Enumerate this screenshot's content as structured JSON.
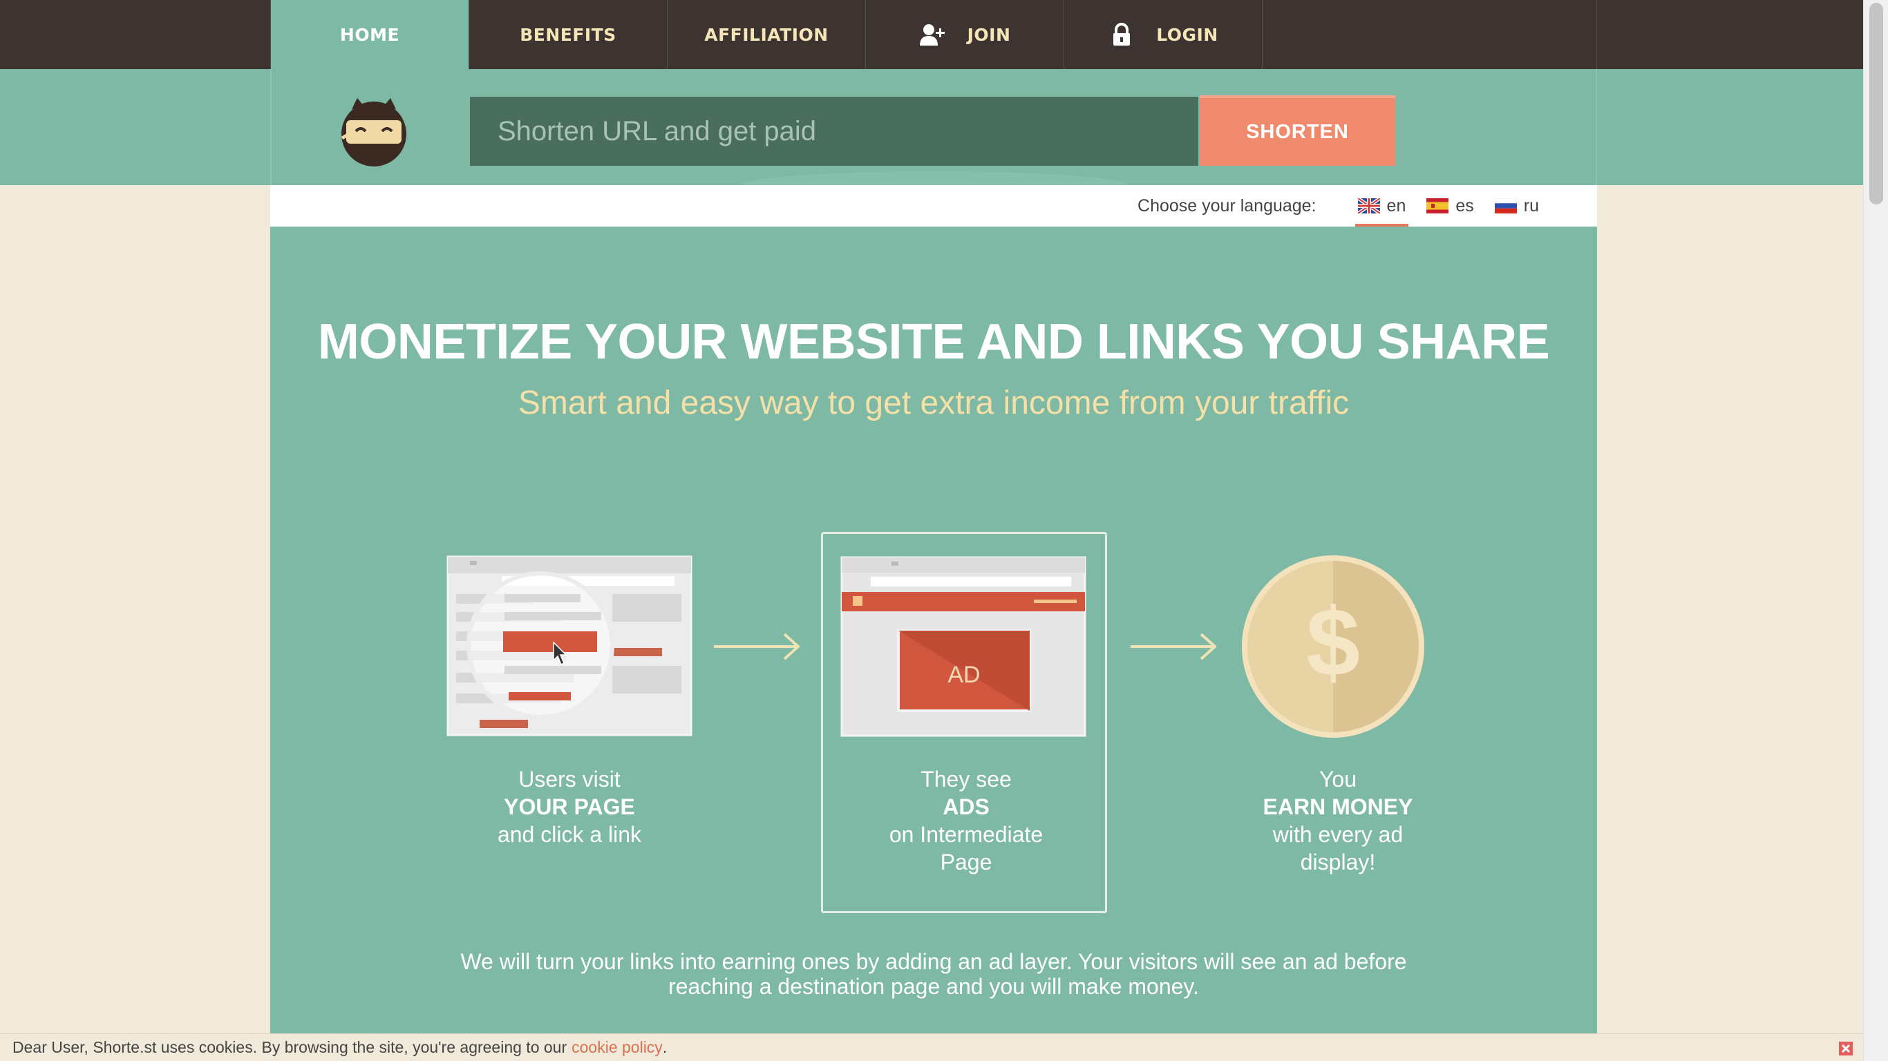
{
  "nav": {
    "items": [
      {
        "label": "HOME",
        "icon": ""
      },
      {
        "label": "BENEFITS",
        "icon": ""
      },
      {
        "label": "AFFILIATION",
        "icon": ""
      },
      {
        "label": "JOIN",
        "icon": "add-user-icon"
      },
      {
        "label": "LOGIN",
        "icon": "lock-icon"
      }
    ],
    "active": "HOME"
  },
  "shortener": {
    "placeholder": "Shorten URL and get paid",
    "value": "",
    "button_label": "SHORTEN"
  },
  "language": {
    "label": "Choose your language:",
    "options": [
      {
        "code": "en",
        "flag": "uk-flag-icon"
      },
      {
        "code": "es",
        "flag": "spain-flag-icon"
      },
      {
        "code": "ru",
        "flag": "russia-flag-icon"
      }
    ],
    "active": "en"
  },
  "hero": {
    "title": "MONETIZE YOUR WEBSITE AND LINKS YOU SHARE",
    "subtitle": "Smart and easy way to get extra income from your traffic"
  },
  "steps": [
    {
      "line1": "Users visit",
      "strong": "YOUR PAGE",
      "line3": "and click a link",
      "line4": ""
    },
    {
      "line1": "They see",
      "strong": "ADS",
      "line3": "on Intermediate",
      "line4": "Page",
      "ad_label": "AD"
    },
    {
      "line1": "You",
      "strong": "EARN MONEY",
      "line3": "with every ad",
      "line4": "display!",
      "coin_symbol": "$"
    }
  ],
  "description": "We will turn your links into earning ones by adding an ad layer. Your visitors will see an ad before reaching a destination page and you will make money.",
  "cookie_notice": {
    "text": "Dear User, Shorte.st uses cookies. By browsing the site, you're agreeing to our",
    "link_text": "cookie policy",
    "suffix": "."
  },
  "colors": {
    "nav_bg": "#3d3431",
    "mint": "#7db9a4",
    "input_bg": "#4a6e5e",
    "accent": "#ef8a6d",
    "page_bg": "#f1eadb",
    "subtitle": "#f5e0a8"
  }
}
